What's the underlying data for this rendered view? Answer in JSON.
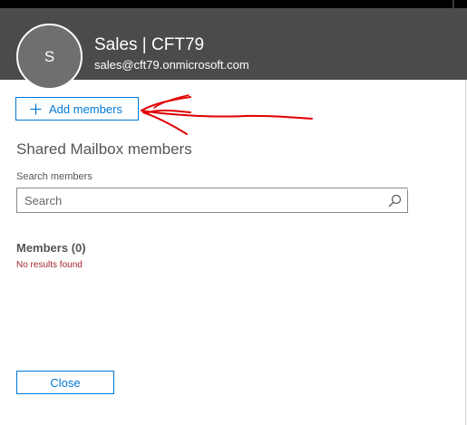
{
  "panel": {
    "avatar_initial": "S",
    "title": "Sales | CFT79",
    "email": "sales@cft79.onmicrosoft.com"
  },
  "actions": {
    "add_members_label": "Add members",
    "close_label": "Close"
  },
  "section": {
    "title": "Shared Mailbox members"
  },
  "search": {
    "label": "Search members",
    "placeholder": "Search",
    "value": ""
  },
  "members": {
    "heading": "Members (0)",
    "empty_message": "No results found"
  },
  "icons": {
    "add": "plus-icon",
    "search": "search-icon"
  },
  "colors": {
    "header_bg": "#4b4b4b",
    "accent": "#0078d4",
    "error": "#a4262c",
    "annotation": "#e00000"
  }
}
